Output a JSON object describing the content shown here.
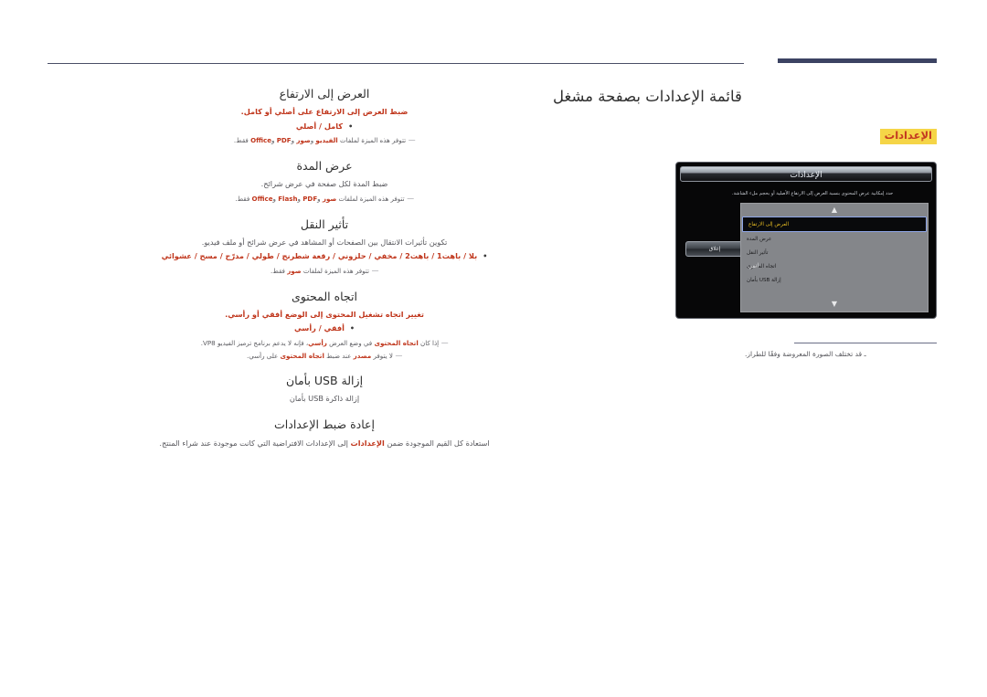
{
  "header": {
    "page_title": "قائمة الإعدادات بصفحة مشغل",
    "settings_chip": "الإعدادات"
  },
  "osd": {
    "title": "الإعدادات",
    "description": "حدد إمكانية عرض المحتوى بنسبة العرض إلى الارتفاع الأصلية أو بحجم ملء الشاشة.",
    "close_label": "إغلاق",
    "scroll_up_icon": "chevron-up-icon",
    "scroll_down_icon": "chevron-down-icon",
    "items": [
      {
        "label": "العرض إلى الارتفاع",
        "value": "",
        "selected": true
      },
      {
        "label": "عرض المدة",
        "value": "",
        "selected": false
      },
      {
        "label": "تأثير النقل",
        "value": "",
        "selected": false
      },
      {
        "label": "اتجاه المحتوى",
        "value": "أفقي",
        "selected": false
      },
      {
        "label": "إزالة USB بأمان",
        "value": "",
        "selected": false
      }
    ]
  },
  "note": {
    "text": "ـ قد تختلف الصورة المعروضة وفقًا للطراز."
  },
  "sections": [
    {
      "id": "aspect-ratio",
      "title": "العرض إلى الارتفاع",
      "desc_pre": "ضبط ",
      "desc_em1": "العرض إلى الارتفاع",
      "desc_mid": " على ",
      "desc_em2": "أصلي",
      "desc_post": " أو ",
      "desc_em3": "كامل",
      "desc_end": ".",
      "bullet": "كامل / أصلي",
      "notes": [
        {
          "pre": "تتوفر هذه الميزة لملفات ",
          "em1": "الفيديو",
          "mid1": " و",
          "em2": "صور",
          "mid2": " و",
          "em3": "PDF",
          "mid3": " و",
          "em4": "Office",
          "post": " فقط."
        }
      ]
    },
    {
      "id": "duration",
      "title": "عرض المدة",
      "desc_plain": "ضبط المدة لكل صفحة في عرض شرائح.",
      "notes": [
        {
          "pre": "تتوفر هذه الميزة لملفات ",
          "em1": "صور",
          "mid1": " و",
          "em2": "PDF",
          "mid2": " و",
          "em3": "Flash",
          "mid3": " و",
          "em4": "Office",
          "post": " فقط."
        }
      ]
    },
    {
      "id": "transition",
      "title": "تأثير النقل",
      "desc_plain": "تكوين تأثيرات الانتقال بين الصفحات أو المشاهد في عرض شرائح أو ملف فيديو.",
      "bullet": "بلا / باهت1 / باهت2 / مخفي / حلزوني / رقعة شطرنج / طولي / مدرّج / مسح / عشوائي",
      "notes": [
        {
          "pre": "تتوفر هذه الميزة لملفات ",
          "em1": "صور",
          "post": " فقط."
        }
      ]
    },
    {
      "id": "content-orientation",
      "title": "اتجاه المحتوى",
      "desc_pre": "تغيير اتجاه تشغيل المحتوى إلى الوضع ",
      "desc_em1": "أفقي",
      "desc_mid": " أو ",
      "desc_em2": "رأسي",
      "desc_end": ".",
      "bullet": "أفقي / رأسي",
      "notes": [
        {
          "pre": "إذا كان ",
          "em1": "اتجاه المحتوى",
          "mid1": " في وضع العرض ",
          "em2": "رأسي",
          "post": "، فإنه لا يدعم برنامج ترميز الفيديو VP8."
        },
        {
          "pre": "لا يتوفر ",
          "em1": "مصدر",
          "mid1": " عند ضبط ",
          "em2": "اتجاه المحتوى",
          "post": " على رأسي."
        }
      ]
    },
    {
      "id": "safe-usb-removal",
      "title": "إزالة USB بأمان",
      "desc_plain": "إزالة ذاكرة USB بأمان"
    },
    {
      "id": "reset-settings",
      "title": "إعادة ضبط الإعدادات",
      "reset_pre": "استعادة كل القيم الموجودة ضمن ",
      "reset_em": "الإعدادات",
      "reset_post": " إلى الإعدادات الافتراضية التي كانت موجودة عند شراء المنتج."
    }
  ]
}
